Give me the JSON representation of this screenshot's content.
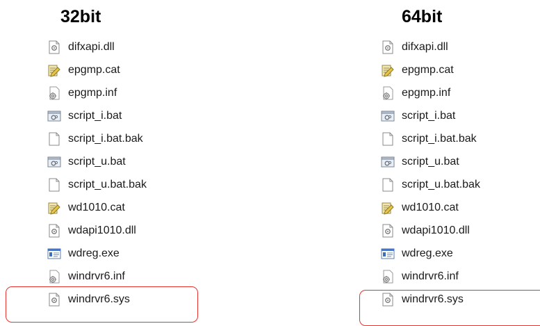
{
  "panels": [
    {
      "heading": "32bit",
      "files": [
        {
          "name": "difxapi.dll",
          "icon": "dll-icon"
        },
        {
          "name": "epgmp.cat",
          "icon": "catalog-icon"
        },
        {
          "name": "epgmp.inf",
          "icon": "setup-info-icon"
        },
        {
          "name": "script_i.bat",
          "icon": "batch-icon"
        },
        {
          "name": "script_i.bat.bak",
          "icon": "blank-file-icon"
        },
        {
          "name": "script_u.bat",
          "icon": "batch-icon"
        },
        {
          "name": "script_u.bat.bak",
          "icon": "blank-file-icon"
        },
        {
          "name": "wd1010.cat",
          "icon": "catalog-icon"
        },
        {
          "name": "wdapi1010.dll",
          "icon": "dll-icon"
        },
        {
          "name": "wdreg.exe",
          "icon": "exe-icon"
        },
        {
          "name": "windrvr6.inf",
          "icon": "setup-info-icon"
        },
        {
          "name": "windrvr6.sys",
          "icon": "sys-icon"
        }
      ]
    },
    {
      "heading": "64bit",
      "files": [
        {
          "name": "difxapi.dll",
          "icon": "dll-icon"
        },
        {
          "name": "epgmp.cat",
          "icon": "catalog-icon"
        },
        {
          "name": "epgmp.inf",
          "icon": "setup-info-icon"
        },
        {
          "name": "script_i.bat",
          "icon": "batch-icon"
        },
        {
          "name": "script_i.bat.bak",
          "icon": "blank-file-icon"
        },
        {
          "name": "script_u.bat",
          "icon": "batch-icon"
        },
        {
          "name": "script_u.bat.bak",
          "icon": "blank-file-icon"
        },
        {
          "name": "wd1010.cat",
          "icon": "catalog-icon"
        },
        {
          "name": "wdapi1010.dll",
          "icon": "dll-icon"
        },
        {
          "name": "wdreg.exe",
          "icon": "exe-icon"
        },
        {
          "name": "windrvr6.inf",
          "icon": "setup-info-icon"
        },
        {
          "name": "windrvr6.sys",
          "icon": "sys-icon"
        }
      ]
    }
  ],
  "highlight": {
    "file": "windrvr6.sys",
    "color": "#e8322e"
  }
}
